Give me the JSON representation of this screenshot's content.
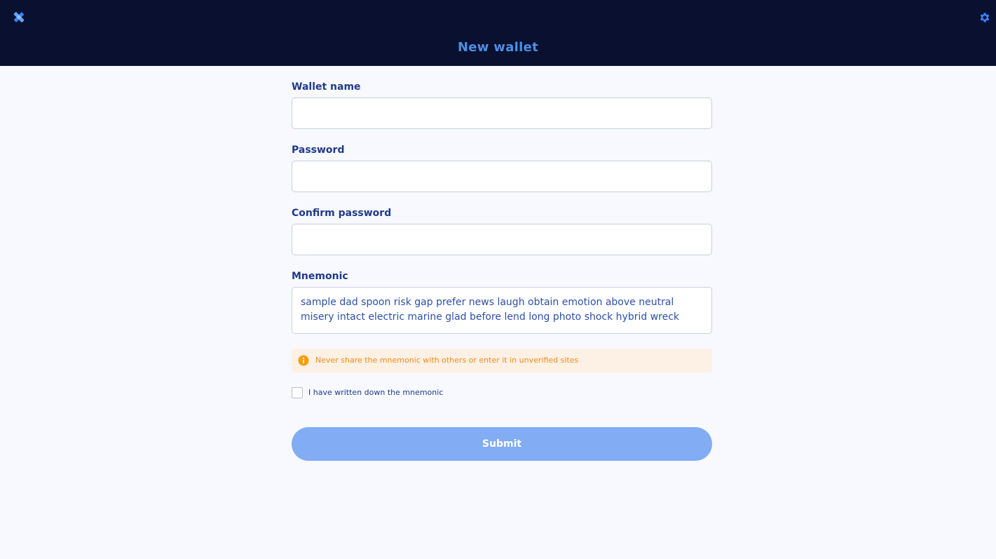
{
  "header": {
    "title": "New wallet",
    "logo_icon": "satellite-icon",
    "settings_icon": "gear-icon",
    "background": "#0a1030",
    "accent": "#4a8fe6"
  },
  "form": {
    "wallet_name": {
      "label": "Wallet name",
      "value": ""
    },
    "password": {
      "label": "Password",
      "value": ""
    },
    "confirm_password": {
      "label": "Confirm password",
      "value": ""
    },
    "mnemonic": {
      "label": "Mnemonic",
      "value": "sample dad spoon risk gap prefer news laugh obtain emotion above neutral misery intact electric marine glad before lend long photo shock hybrid wreck"
    },
    "warning": {
      "icon": "info-icon",
      "text": "Never share the mnemonic with others or enter it in unverified sites",
      "color": "#f08c1a"
    },
    "confirm_checkbox": {
      "label": "I have written down the mnemonic",
      "checked": false
    },
    "submit_label": "Submit",
    "submit_color": "#82acf3"
  }
}
